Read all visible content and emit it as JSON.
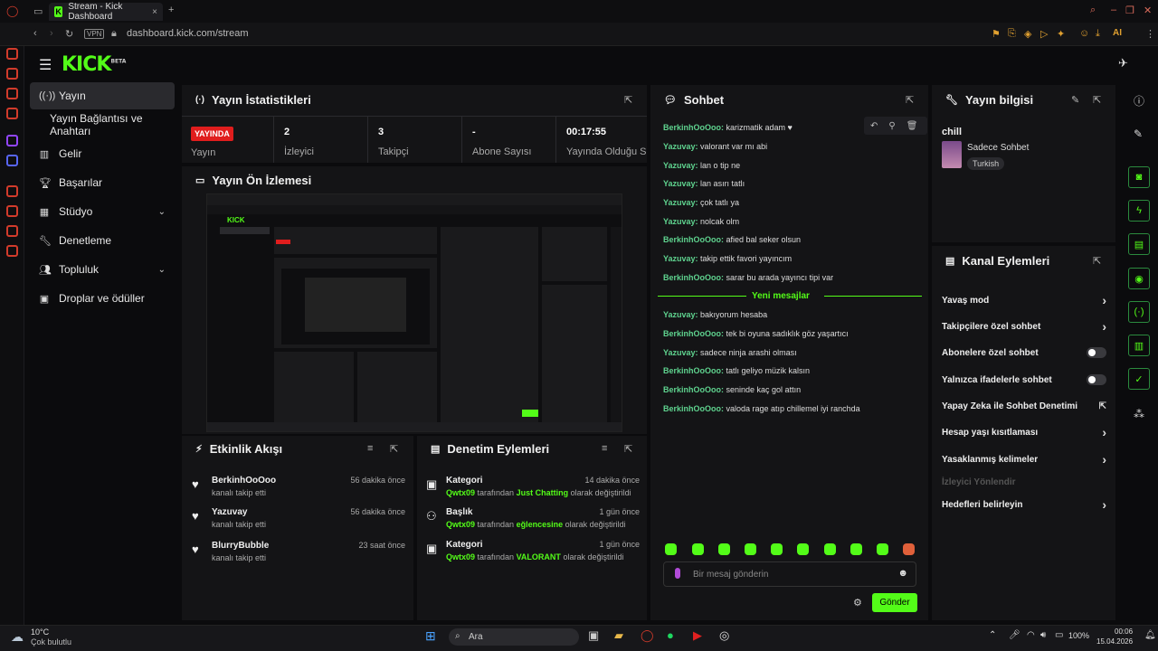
{
  "browser": {
    "tab_title": "Stream - Kick Dashboard",
    "url": "dashboard.kick.com/stream",
    "vpn": "VPN",
    "ai": "AI"
  },
  "brand": {
    "logo": "KICK",
    "beta": "BETA",
    "accent": "#53fc18"
  },
  "nav": {
    "items": [
      {
        "label": "Yayın",
        "icon": "broadcast-icon"
      },
      {
        "label": "Yayın Bağlantısı ve Anahtarı",
        "icon": ""
      },
      {
        "label": "Gelir",
        "icon": "chart-icon"
      },
      {
        "label": "Başarılar",
        "icon": "trophy-icon"
      },
      {
        "label": "Stüdyo",
        "icon": "studio-icon"
      },
      {
        "label": "Denetleme",
        "icon": "wrench-icon"
      },
      {
        "label": "Topluluk",
        "icon": "community-icon"
      },
      {
        "label": "Droplar ve ödüller",
        "icon": "gift-icon"
      }
    ]
  },
  "stats": {
    "title": "Yayın İstatistikleri",
    "live": "YAYINDA",
    "live_label": "Yayın",
    "viewers": {
      "value": "2",
      "label": "İzleyici"
    },
    "followers": {
      "value": "3",
      "label": "Takipçi"
    },
    "subs": {
      "value": "-",
      "label": "Abone Sayısı"
    },
    "uptime": {
      "value": "00:17:55",
      "label": "Yayında Olduğu Süre"
    }
  },
  "preview": {
    "title": "Yayın Ön İzlemesi"
  },
  "activity": {
    "title": "Etkinlik Akışı",
    "items": [
      {
        "user": "BerkinhOoOoo",
        "text": "kanalı takip etti",
        "time": "56 dakika önce"
      },
      {
        "user": "Yazuvay",
        "text": "kanalı takip etti",
        "time": "56 dakika önce"
      },
      {
        "user": "BlurryBubble",
        "text": "kanalı takip etti",
        "time": "23 saat önce"
      }
    ]
  },
  "moderation": {
    "title": "Denetim Eylemleri",
    "items": [
      {
        "title": "Kategori",
        "user": "Qwtx09",
        "mid": "tarafından",
        "value": "Just Chatting",
        "end": "olarak değiştirildi",
        "time": "14 dakika önce"
      },
      {
        "title": "Başlık",
        "user": "Qwtx09",
        "mid": "tarafından",
        "value": "eğlencesine",
        "end": "olarak değiştirildi",
        "time": "1 gün önce"
      },
      {
        "title": "Kategori",
        "user": "Qwtx09",
        "mid": "tarafından",
        "value": "VALORANT",
        "end": "olarak değiştirildi",
        "time": "1 gün önce"
      }
    ]
  },
  "chat": {
    "title": "Sohbet",
    "messages": [
      {
        "user": "BerkinhOoOoo:",
        "text": "karizmatik adam ♥"
      },
      {
        "user": "Yazuvay:",
        "text": "valorant var mı abi"
      },
      {
        "user": "Yazuvay:",
        "text": "lan o tip ne"
      },
      {
        "user": "Yazuvay:",
        "text": "lan asırı tatlı"
      },
      {
        "user": "Yazuvay:",
        "text": "çok tatlı ya"
      },
      {
        "user": "Yazuvay:",
        "text": "nolcak olm"
      },
      {
        "user": "BerkinhOoOoo:",
        "text": "afied bal seker olsun"
      },
      {
        "user": "Yazuvay:",
        "text": "takip ettik favori yayıncım"
      },
      {
        "user": "BerkinhOoOoo:",
        "text": "sarar bu arada yayıncı tipi var"
      }
    ],
    "new_label": "Yeni mesajlar",
    "new_messages": [
      {
        "user": "Yazuvay:",
        "text": "bakıyorum hesaba"
      },
      {
        "user": "BerkinhOoOoo:",
        "text": "tek bi oyuna sadıklık göz yaşartıcı"
      },
      {
        "user": "Yazuvay:",
        "text": "sadece ninja arashi olması"
      },
      {
        "user": "BerkinhOoOoo:",
        "text": "tatlı geliyo müzik kalsın"
      },
      {
        "user": "BerkinhOoOoo:",
        "text": "seninde kaç gol attın"
      },
      {
        "user": "BerkinhOoOoo:",
        "text": "valoda rage atıp chillemel iyi ranchda"
      }
    ],
    "placeholder": "Bir mesaj gönderin",
    "send": "Gönder"
  },
  "stream_info": {
    "title": "Yayın bilgisi",
    "stream_title": "chill",
    "category": "Sadece Sohbet",
    "language": "Turkish"
  },
  "channel_actions": {
    "title": "Kanal Eylemleri",
    "items": [
      {
        "label": "Yavaş mod",
        "control": "chevron"
      },
      {
        "label": "Takipçilere özel sohbet",
        "control": "chevron"
      },
      {
        "label": "Abonelere özel sohbet",
        "control": "toggle"
      },
      {
        "label": "Yalnızca ifadelerle sohbet",
        "control": "toggle"
      },
      {
        "label": "Yapay Zeka ile Sohbet Denetimi",
        "control": "external"
      },
      {
        "label": "Hesap yaşı kısıtlaması",
        "control": "chevron"
      },
      {
        "label": "Yasaklanmış kelimeler",
        "control": "chevron"
      },
      {
        "label": "İzleyici Yönlendir",
        "control": "disabled"
      },
      {
        "label": "Hedefleri belirleyin",
        "control": "chevron"
      }
    ]
  },
  "taskbar": {
    "weather_temp": "10°C",
    "weather_text": "Çok bulutlu",
    "search": "Ara",
    "time": "00:06",
    "date": "15.04.2026",
    "battery": "100%"
  }
}
